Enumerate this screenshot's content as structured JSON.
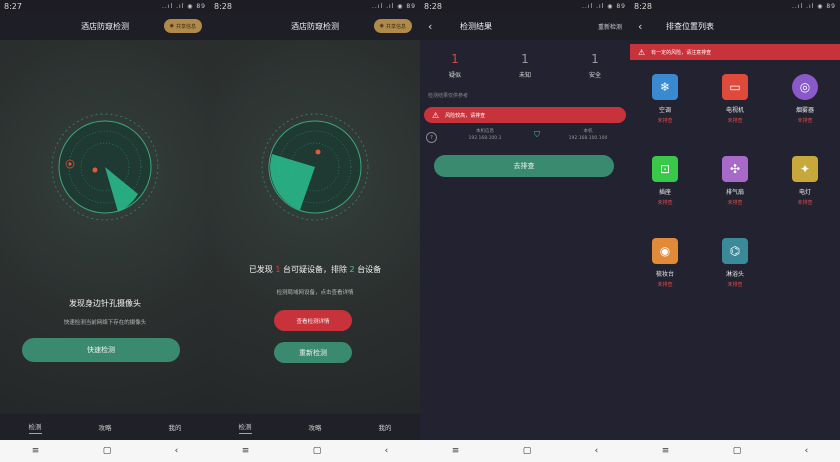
{
  "status_times": [
    "8:27",
    "8:28",
    "8:28",
    "8:28"
  ],
  "status_icons": "..ıl .ıl ◉ 89",
  "screen1": {
    "title": "酒店防窥检测",
    "wifi_label": "共享信息",
    "heading": "发现身边针孔摄像头",
    "sub": "快速检测当前网络下存在的摄像头",
    "button": "快速检测"
  },
  "screen2": {
    "title": "酒店防窥检测",
    "wifi_label": "共享信息",
    "found_pre": "已发现",
    "found_num": "1",
    "found_mid": "台可疑设备，排除",
    "excluded_num": "2",
    "found_post": "台设备",
    "sub": "检测局域网设备，点击查看详情",
    "red_button": "查看检测详情",
    "green_button": "重新检测"
  },
  "screen3": {
    "title": "检测结果",
    "redetect": "重新检测",
    "stats": [
      {
        "num": "1",
        "label": "疑似",
        "red": true
      },
      {
        "num": "1",
        "label": "未知",
        "red": false
      },
      {
        "num": "1",
        "label": "安全",
        "red": false
      }
    ],
    "section_label": "检测结果仅供参考",
    "alert": "风险较高，请排查",
    "net_left_title": "本机信息",
    "net_left_ip": "192.168.100.1",
    "net_right_title": "本机",
    "net_right_ip": "192.168.100.100",
    "button": "去排查"
  },
  "screen4": {
    "title": "排查位置列表",
    "alert": "有一定的风险，请注意排查",
    "items": [
      {
        "name": "空调",
        "status": "未排查",
        "color": "#3a8ad0",
        "icon": "❄"
      },
      {
        "name": "电视机",
        "status": "未排查",
        "color": "#e04a3a",
        "icon": "▭"
      },
      {
        "name": "烟雾器",
        "status": "未排查",
        "color": "#8a5ac8",
        "icon": "◎"
      },
      {
        "name": "插座",
        "status": "未排查",
        "color": "#3ac84a",
        "icon": "⊡"
      },
      {
        "name": "排气扇",
        "status": "未排查",
        "color": "#a86ac8",
        "icon": "✣"
      },
      {
        "name": "电灯",
        "status": "未排查",
        "color": "#c8a83a",
        "icon": "✦"
      },
      {
        "name": "梳妆台",
        "status": "未排查",
        "color": "#e08a3a",
        "icon": "◉"
      },
      {
        "name": "淋浴头",
        "status": "未排查",
        "color": "#3a8a9a",
        "icon": "⌬"
      }
    ]
  },
  "tabs": [
    "检测",
    "攻略",
    "我的"
  ],
  "nav": [
    "≡",
    "▢",
    "‹"
  ]
}
